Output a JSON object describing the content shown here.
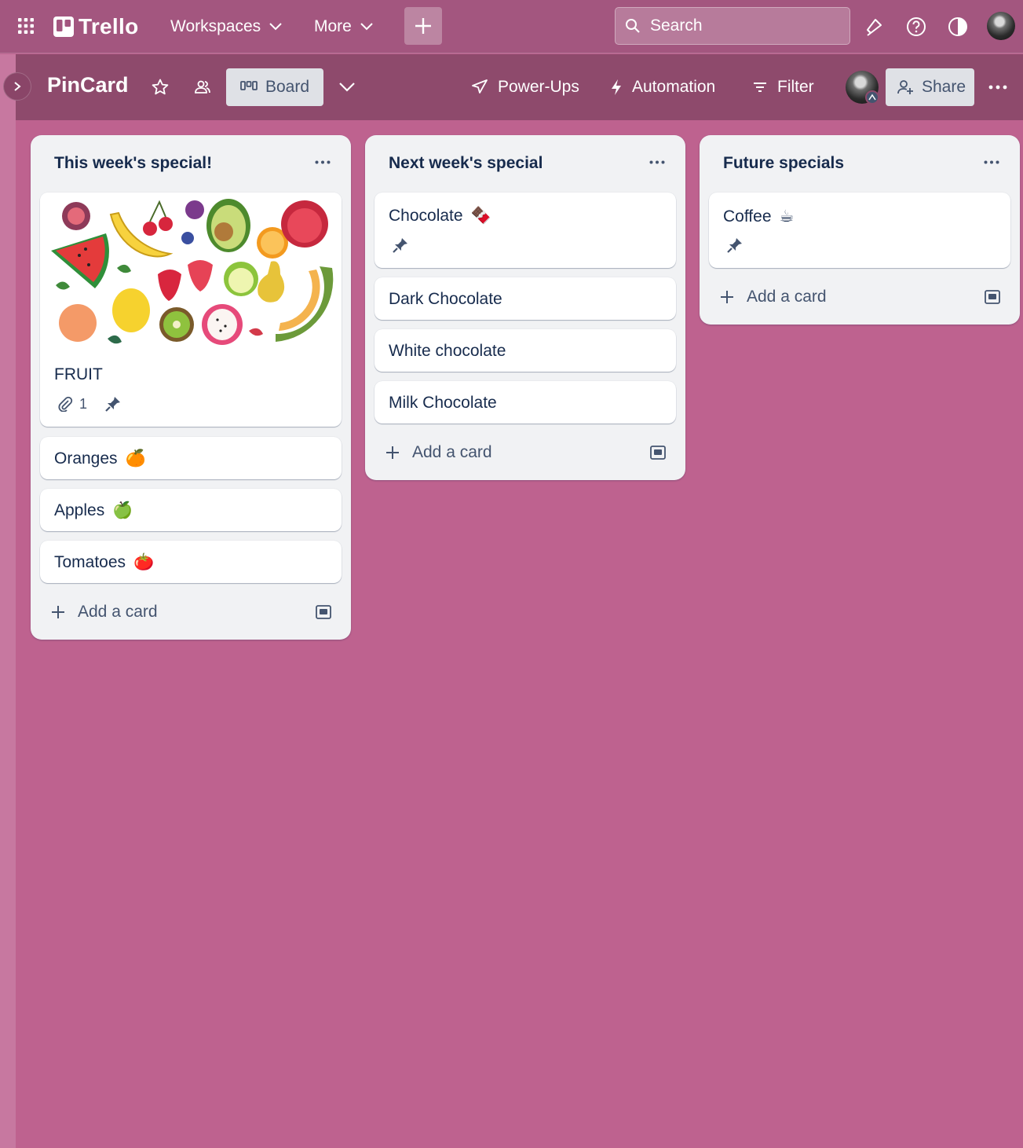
{
  "topbar": {
    "app_name": "Trello",
    "workspaces_label": "Workspaces",
    "more_label": "More",
    "search_placeholder": "Search"
  },
  "board": {
    "title": "PinCard",
    "view_label": "Board",
    "powerups_label": "Power-Ups",
    "automation_label": "Automation",
    "filter_label": "Filter",
    "share_label": "Share"
  },
  "lists": [
    {
      "title": "This week's special!",
      "cards": [
        {
          "title": "FRUIT",
          "attachments": "1",
          "pinned": true,
          "has_cover": true
        },
        {
          "title": "Oranges",
          "emoji": "🍊"
        },
        {
          "title": "Apples",
          "emoji": "🍏"
        },
        {
          "title": "Tomatoes",
          "emoji": "🍅"
        }
      ],
      "add_label": "Add a card"
    },
    {
      "title": "Next week's special",
      "cards": [
        {
          "title": "Chocolate",
          "emoji": "🍫",
          "pinned": true
        },
        {
          "title": "Dark Chocolate"
        },
        {
          "title": "White chocolate"
        },
        {
          "title": "Milk Chocolate"
        }
      ],
      "add_label": "Add a card"
    },
    {
      "title": "Future specials",
      "cards": [
        {
          "title": "Coffee",
          "emoji": "☕",
          "pinned": true
        }
      ],
      "add_label": "Add a card"
    }
  ],
  "colors": {
    "topbar": "#a3567f",
    "board_header": "#8e4a6c",
    "board_bg": "#be628f",
    "list_bg": "#f1f2f4"
  }
}
